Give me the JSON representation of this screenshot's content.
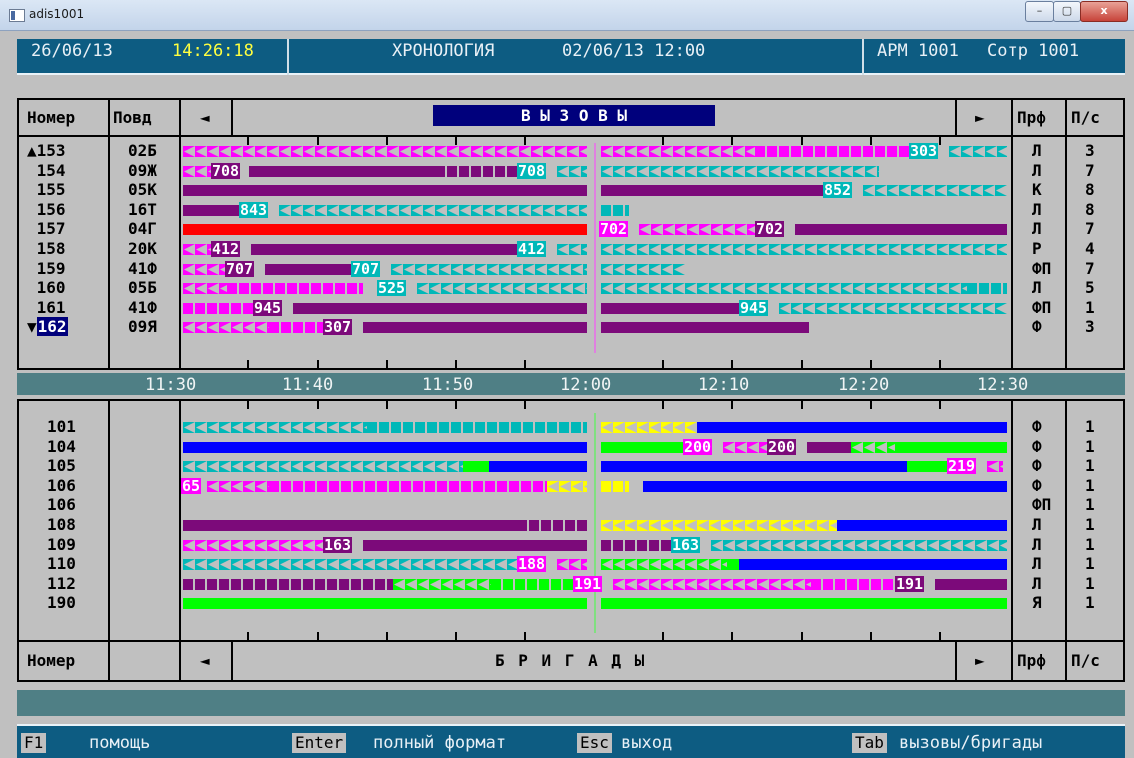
{
  "window": {
    "title": "adis1001",
    "minimize": "–",
    "maximize": "▢",
    "close": "x"
  },
  "header": {
    "date": "26/06/13",
    "time": "14:26:18",
    "mode": "ХРОНОЛОГИЯ",
    "mode_datetime": "02/06/13 12:00",
    "workstation": "АРМ 1001",
    "operator": "Сотр 1001"
  },
  "calls": {
    "col_number": "Номер",
    "col_reason": "Повд",
    "nav_left": "◄",
    "nav_right": "►",
    "title": "В Ы З О В Ы",
    "col_profile": "Прф",
    "col_ps": "П/с",
    "rows": [
      {
        "number": "153",
        "marker": "▲",
        "reason": "02Б",
        "profile": "Л",
        "ps": "3"
      },
      {
        "number": "154",
        "marker": "",
        "reason": "09Ж",
        "profile": "Л",
        "ps": "7"
      },
      {
        "number": "155",
        "marker": "",
        "reason": "05К",
        "profile": "К",
        "ps": "8"
      },
      {
        "number": "156",
        "marker": "",
        "reason": "16Т",
        "profile": "Л",
        "ps": "8"
      },
      {
        "number": "157",
        "marker": "",
        "reason": "04Г",
        "profile": "Л",
        "ps": "7"
      },
      {
        "number": "158",
        "marker": "",
        "reason": "20К",
        "profile": "Р",
        "ps": "4"
      },
      {
        "number": "159",
        "marker": "",
        "reason": "41Ф",
        "profile": "ФП",
        "ps": "7"
      },
      {
        "number": "160",
        "marker": "",
        "reason": "05Б",
        "profile": "Л",
        "ps": "5"
      },
      {
        "number": "161",
        "marker": "",
        "reason": "41Ф",
        "profile": "ФП",
        "ps": "1"
      },
      {
        "number": "162",
        "marker": "▼",
        "reason": "09Я",
        "profile": "Ф",
        "ps": "3"
      }
    ]
  },
  "timeline": {
    "labels": [
      "11:30",
      "11:40",
      "11:50",
      "12:00",
      "12:10",
      "12:20",
      "12:30"
    ]
  },
  "brigades": {
    "col_number": "Номер",
    "nav_left": "◄",
    "nav_right": "►",
    "title": "Б Р И Г А Д Ы",
    "col_profile": "Прф",
    "col_ps": "П/с",
    "rows": [
      {
        "number": "101",
        "profile": "Ф",
        "ps": "1"
      },
      {
        "number": "104",
        "profile": "Ф",
        "ps": "1"
      },
      {
        "number": "105",
        "profile": "Ф",
        "ps": "1"
      },
      {
        "number": "106",
        "profile": "Ф",
        "ps": "1"
      },
      {
        "number": "106",
        "profile": "ФП",
        "ps": "1"
      },
      {
        "number": "108",
        "profile": "Л",
        "ps": "1"
      },
      {
        "number": "109",
        "profile": "Л",
        "ps": "1"
      },
      {
        "number": "110",
        "profile": "Л",
        "ps": "1"
      },
      {
        "number": "112",
        "profile": "Л",
        "ps": "1"
      },
      {
        "number": "190",
        "profile": "Я",
        "ps": "1"
      }
    ]
  },
  "tags": {
    "t303": "303",
    "t708a": "708",
    "t708b": "708",
    "t852": "852",
    "t843": "843",
    "t702a": "702",
    "t702b": "702",
    "t412a": "412",
    "t412b": "412",
    "t707a": "707",
    "t707b": "707",
    "t525": "525",
    "t945a": "945",
    "t945b": "945",
    "t307": "307",
    "t200a": "200",
    "t200b": "200",
    "t219": "219",
    "t65": "65",
    "t163a": "163",
    "t163b": "163",
    "t188": "188",
    "t191a": "191",
    "t191b": "191"
  },
  "colors": {
    "magenta": "#ff00ff",
    "cyan": "#00b8b8",
    "purple": "#7c0a7a",
    "red": "#ff0000",
    "blue": "#0000ff",
    "green": "#00ff00",
    "yellow": "#ffff00",
    "header_bg": "#0d5c82"
  },
  "footer": {
    "f1_key": "F1",
    "f1_label": "помощь",
    "enter_key": "Enter",
    "enter_label": "полный формат",
    "esc_key": "Esc",
    "esc_label": "выход",
    "tab_key": "Tab",
    "tab_label": "вызовы/бригады"
  }
}
